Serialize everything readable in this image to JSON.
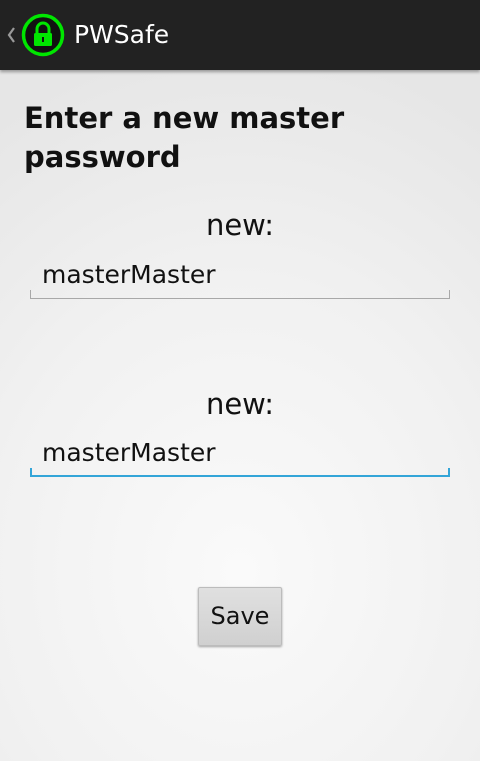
{
  "action_bar": {
    "title": "PWSafe",
    "up_icon": "chevron-left-icon",
    "app_icon": "lock-icon",
    "app_icon_color": "#00e600",
    "background": "#222222"
  },
  "form": {
    "heading": "Enter a new master password",
    "fields": [
      {
        "label": "new:",
        "value": "masterMaster",
        "focused": false
      },
      {
        "label": "new:",
        "value": "masterMaster",
        "focused": true
      }
    ],
    "focus_color": "#33a5d8",
    "save_label": "Save"
  }
}
